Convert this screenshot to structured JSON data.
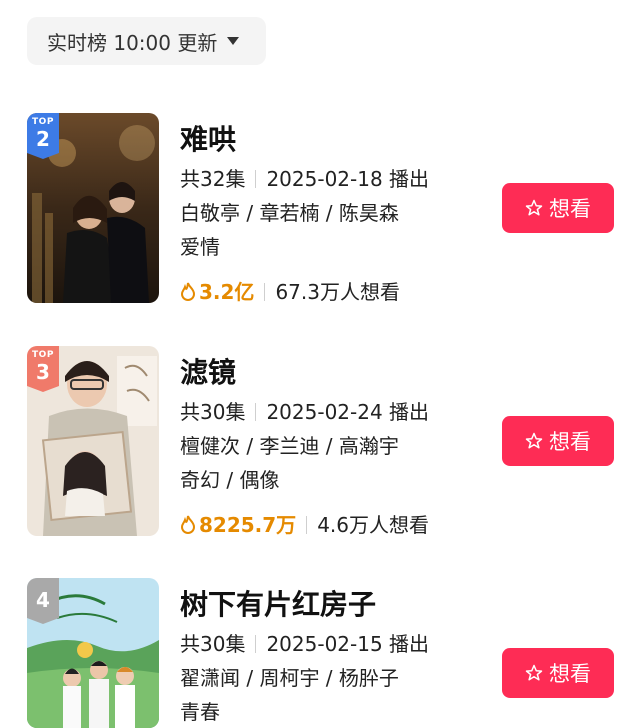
{
  "header": {
    "update_label": "实时榜 10:00 更新"
  },
  "items": [
    {
      "rank": "2",
      "rank_prefix": "TOP",
      "title": "难哄",
      "episodes": "共32集",
      "air_date": "2025-02-18 播出",
      "cast": "白敬亭 / 章若楠 / 陈昊森",
      "genre": "爱情",
      "heat": "3.2亿",
      "want_count": "67.3万人想看",
      "button_label": "想看",
      "poster_icon": "poster-couple-night-city"
    },
    {
      "rank": "3",
      "rank_prefix": "TOP",
      "title": "滤镜",
      "episodes": "共30集",
      "air_date": "2025-02-24 播出",
      "cast": "檀健次 / 李兰迪 / 高瀚宇",
      "genre": "奇幻 / 偶像",
      "heat": "8225.7万",
      "want_count": "4.6万人想看",
      "button_label": "想看",
      "poster_icon": "poster-puzzle-portrait"
    },
    {
      "rank": "4",
      "rank_prefix": "",
      "title": "树下有片红房子",
      "episodes": "共30集",
      "air_date": "2025-02-15 播出",
      "cast": "翟潇闻 / 周柯宇 / 杨肸子",
      "genre": "青春",
      "heat": "",
      "want_count": "",
      "button_label": "想看",
      "poster_icon": "poster-school-youth"
    }
  ],
  "colors": {
    "accent": "#fe2c55",
    "heat": "#e58a00",
    "badge_top2": "#3d7be6",
    "badge_top3": "#f07a6a",
    "badge_4": "#a9a9a9"
  }
}
